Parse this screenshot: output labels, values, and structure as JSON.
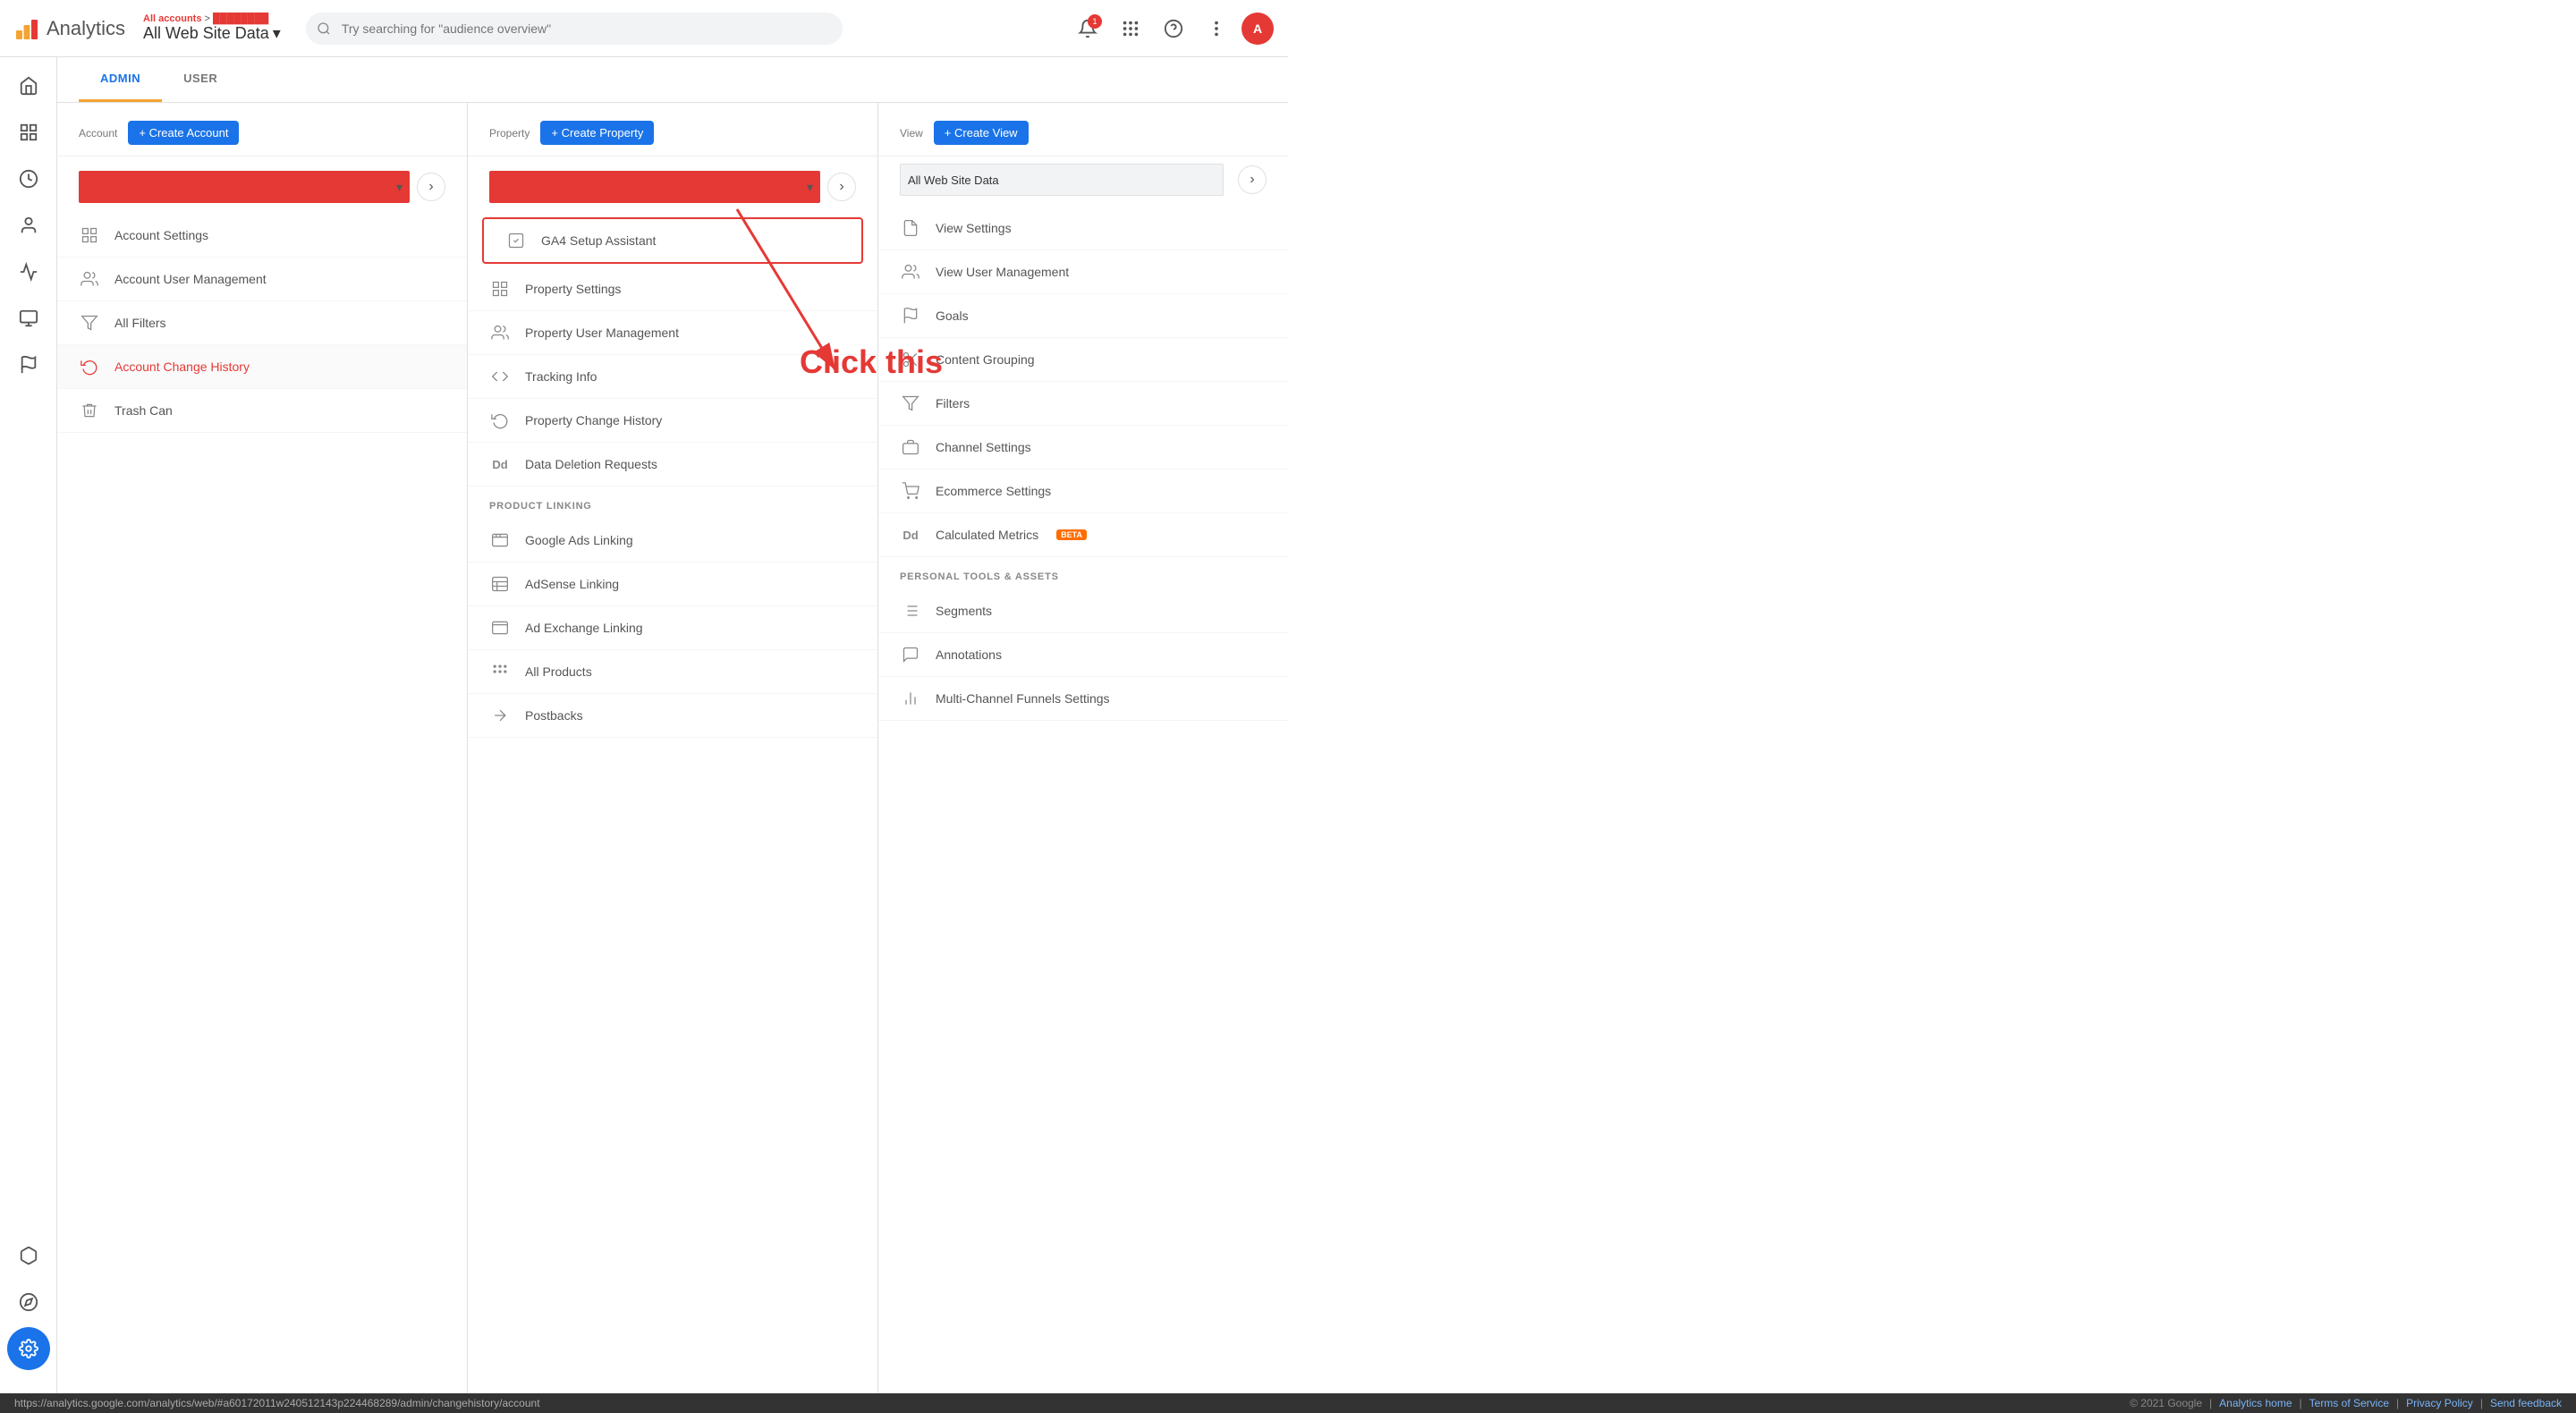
{
  "app": {
    "title": "Analytics",
    "logo_colors": [
      "#f4a433",
      "#e53935",
      "#fbbc04"
    ]
  },
  "header": {
    "all_accounts_label": "All accounts",
    "site_label": "All Web Site Data",
    "dropdown_arrow": "▾",
    "search_placeholder": "Try searching for \"audience overview\"",
    "notification_count": "1"
  },
  "tabs": {
    "admin_label": "ADMIN",
    "user_label": "USER",
    "active": "admin"
  },
  "account_col": {
    "title": "Account",
    "create_label": "+ Create Account",
    "items": [
      {
        "id": "account-settings",
        "label": "Account Settings",
        "icon": "grid"
      },
      {
        "id": "account-user-management",
        "label": "Account User Management",
        "icon": "people"
      },
      {
        "id": "all-filters",
        "label": "All Filters",
        "icon": "filter"
      },
      {
        "id": "account-change-history",
        "label": "Account Change History",
        "icon": "history",
        "active": true
      },
      {
        "id": "trash-can",
        "label": "Trash Can",
        "icon": "trash"
      }
    ]
  },
  "property_col": {
    "title": "Property",
    "create_label": "+ Create Property",
    "items": [
      {
        "id": "ga4-setup",
        "label": "GA4 Setup Assistant",
        "icon": "check-square",
        "highlighted": true
      },
      {
        "id": "property-settings",
        "label": "Property Settings",
        "icon": "settings-grid"
      },
      {
        "id": "property-user-management",
        "label": "Property User Management",
        "icon": "people"
      },
      {
        "id": "tracking-info",
        "label": "Tracking Info",
        "icon": "code"
      },
      {
        "id": "property-change-history",
        "label": "Property Change History",
        "icon": "history"
      },
      {
        "id": "data-deletion-requests",
        "label": "Data Deletion Requests",
        "icon": "dd"
      }
    ],
    "product_linking_section": "PRODUCT LINKING",
    "product_linking_items": [
      {
        "id": "google-ads-linking",
        "label": "Google Ads Linking",
        "icon": "grid-small"
      },
      {
        "id": "adsense-linking",
        "label": "AdSense Linking",
        "icon": "grid-list"
      },
      {
        "id": "ad-exchange-linking",
        "label": "Ad Exchange Linking",
        "icon": "grid-small"
      },
      {
        "id": "all-products",
        "label": "All Products",
        "icon": "grid-dots"
      },
      {
        "id": "postbacks",
        "label": "Postbacks",
        "icon": "arrow"
      }
    ]
  },
  "view_col": {
    "title": "View",
    "create_label": "+ Create View",
    "select_value": "All Web Site Data",
    "items": [
      {
        "id": "view-settings",
        "label": "View Settings",
        "icon": "doc"
      },
      {
        "id": "view-user-management",
        "label": "View User Management",
        "icon": "people"
      },
      {
        "id": "goals",
        "label": "Goals",
        "icon": "flag"
      },
      {
        "id": "content-grouping",
        "label": "Content Grouping",
        "icon": "scissors"
      },
      {
        "id": "filters",
        "label": "Filters",
        "icon": "filter"
      },
      {
        "id": "channel-settings",
        "label": "Channel Settings",
        "icon": "layers"
      },
      {
        "id": "ecommerce-settings",
        "label": "Ecommerce Settings",
        "icon": "cart"
      },
      {
        "id": "calculated-metrics",
        "label": "Calculated Metrics",
        "icon": "dd",
        "badge": "BETA"
      }
    ],
    "personal_section": "PERSONAL TOOLS & ASSETS",
    "personal_items": [
      {
        "id": "segments",
        "label": "Segments",
        "icon": "list-filter"
      },
      {
        "id": "annotations",
        "label": "Annotations",
        "icon": "comment"
      },
      {
        "id": "multi-channel-funnels",
        "label": "Multi-Channel Funnels Settings",
        "icon": "bar-chart"
      }
    ]
  },
  "annotation": {
    "click_this_text": "Click this"
  },
  "footer": {
    "url": "https://analytics.google.com/analytics/web/#a60172011w240512143p224468289/admin/changehistory/account",
    "copyright": "© 2021 Google",
    "links": [
      "Analytics home",
      "Terms of Service",
      "Privacy Policy",
      "Send feedback"
    ]
  }
}
